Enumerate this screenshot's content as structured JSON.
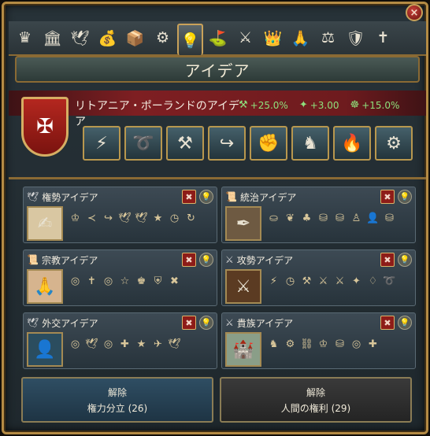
{
  "window": {
    "title": "アイデア",
    "close_label": "×"
  },
  "tabs": [
    {
      "name": "crown-tab-icon",
      "glyph": "♛"
    },
    {
      "name": "court-tab-icon",
      "glyph": "🏛"
    },
    {
      "name": "diplomacy-tab-icon",
      "glyph": "🕊"
    },
    {
      "name": "economy-tab-icon",
      "glyph": "💰"
    },
    {
      "name": "trade-tab-icon",
      "glyph": "📦"
    },
    {
      "name": "production-tab-icon",
      "glyph": "⚙"
    },
    {
      "name": "ideas-tab-icon",
      "glyph": "💡"
    },
    {
      "name": "colonization-tab-icon",
      "glyph": "⛳"
    },
    {
      "name": "military-tab-icon",
      "glyph": "⚔"
    },
    {
      "name": "subjects-tab-icon",
      "glyph": "👑"
    },
    {
      "name": "religion-tab-icon",
      "glyph": "🙏"
    },
    {
      "name": "estates-tab-icon",
      "glyph": "⚖"
    },
    {
      "name": "government-tab-icon",
      "glyph": "🛡"
    },
    {
      "name": "missions-tab-icon",
      "glyph": "✝"
    }
  ],
  "country": {
    "name": "リトアニア・ポーランドのアイデア",
    "modifiers": [
      {
        "icon": "military-icon",
        "glyph": "⚒",
        "value": "+25.0%"
      },
      {
        "icon": "prestige-icon",
        "glyph": "✦",
        "value": "+3.00"
      },
      {
        "icon": "manpower-icon",
        "glyph": "☸",
        "value": "+15.0%"
      }
    ],
    "abilities": [
      "⚡",
      "➰",
      "⚒",
      "↪",
      "✊",
      "♞",
      "🔥",
      "⚙"
    ]
  },
  "groups": [
    {
      "title": "権勢アイデア",
      "icons": [
        "♔",
        "≺",
        "↪",
        "🕊",
        "🕊",
        "★",
        "◷",
        "↻"
      ],
      "portrait": "✍",
      "bg": "#d9c7a2"
    },
    {
      "title": "統治アイデア",
      "icons": [
        "⛀",
        "❦",
        "♣",
        "⛁",
        "⛁",
        "♙",
        "👤",
        "⛁"
      ],
      "portrait": "✒",
      "bg": "#6e5a42"
    },
    {
      "title": "宗教アイデア",
      "icons": [
        "◎",
        "✝",
        "◎",
        "☆",
        "♚",
        "⛨",
        "✖"
      ],
      "portrait": "🙏",
      "bg": "#d6b48e"
    },
    {
      "title": "攻勢アイデア",
      "icons": [
        "⚡",
        "◷",
        "⚒",
        "⚔",
        "⚔",
        "✦",
        "♢",
        "➰"
      ],
      "portrait": "⚔",
      "bg": "#5b3b22"
    },
    {
      "title": "外交アイデア",
      "icons": [
        "◎",
        "🕊",
        "◎",
        "✚",
        "★",
        "✈",
        "🕊"
      ],
      "portrait": "👤",
      "bg": "#2b4d5f"
    },
    {
      "title": "貴族アイデア",
      "icons": [
        "♞",
        "⚙",
        "⛓",
        "♔",
        "⛁",
        "◎",
        "✚"
      ],
      "portrait": "🏰",
      "bg": "#8a9e88"
    }
  ],
  "bottom_buttons": [
    {
      "label": "解除",
      "value": "権力分立 (26)"
    },
    {
      "label": "解除",
      "value": "人間の権利 (29)"
    }
  ]
}
